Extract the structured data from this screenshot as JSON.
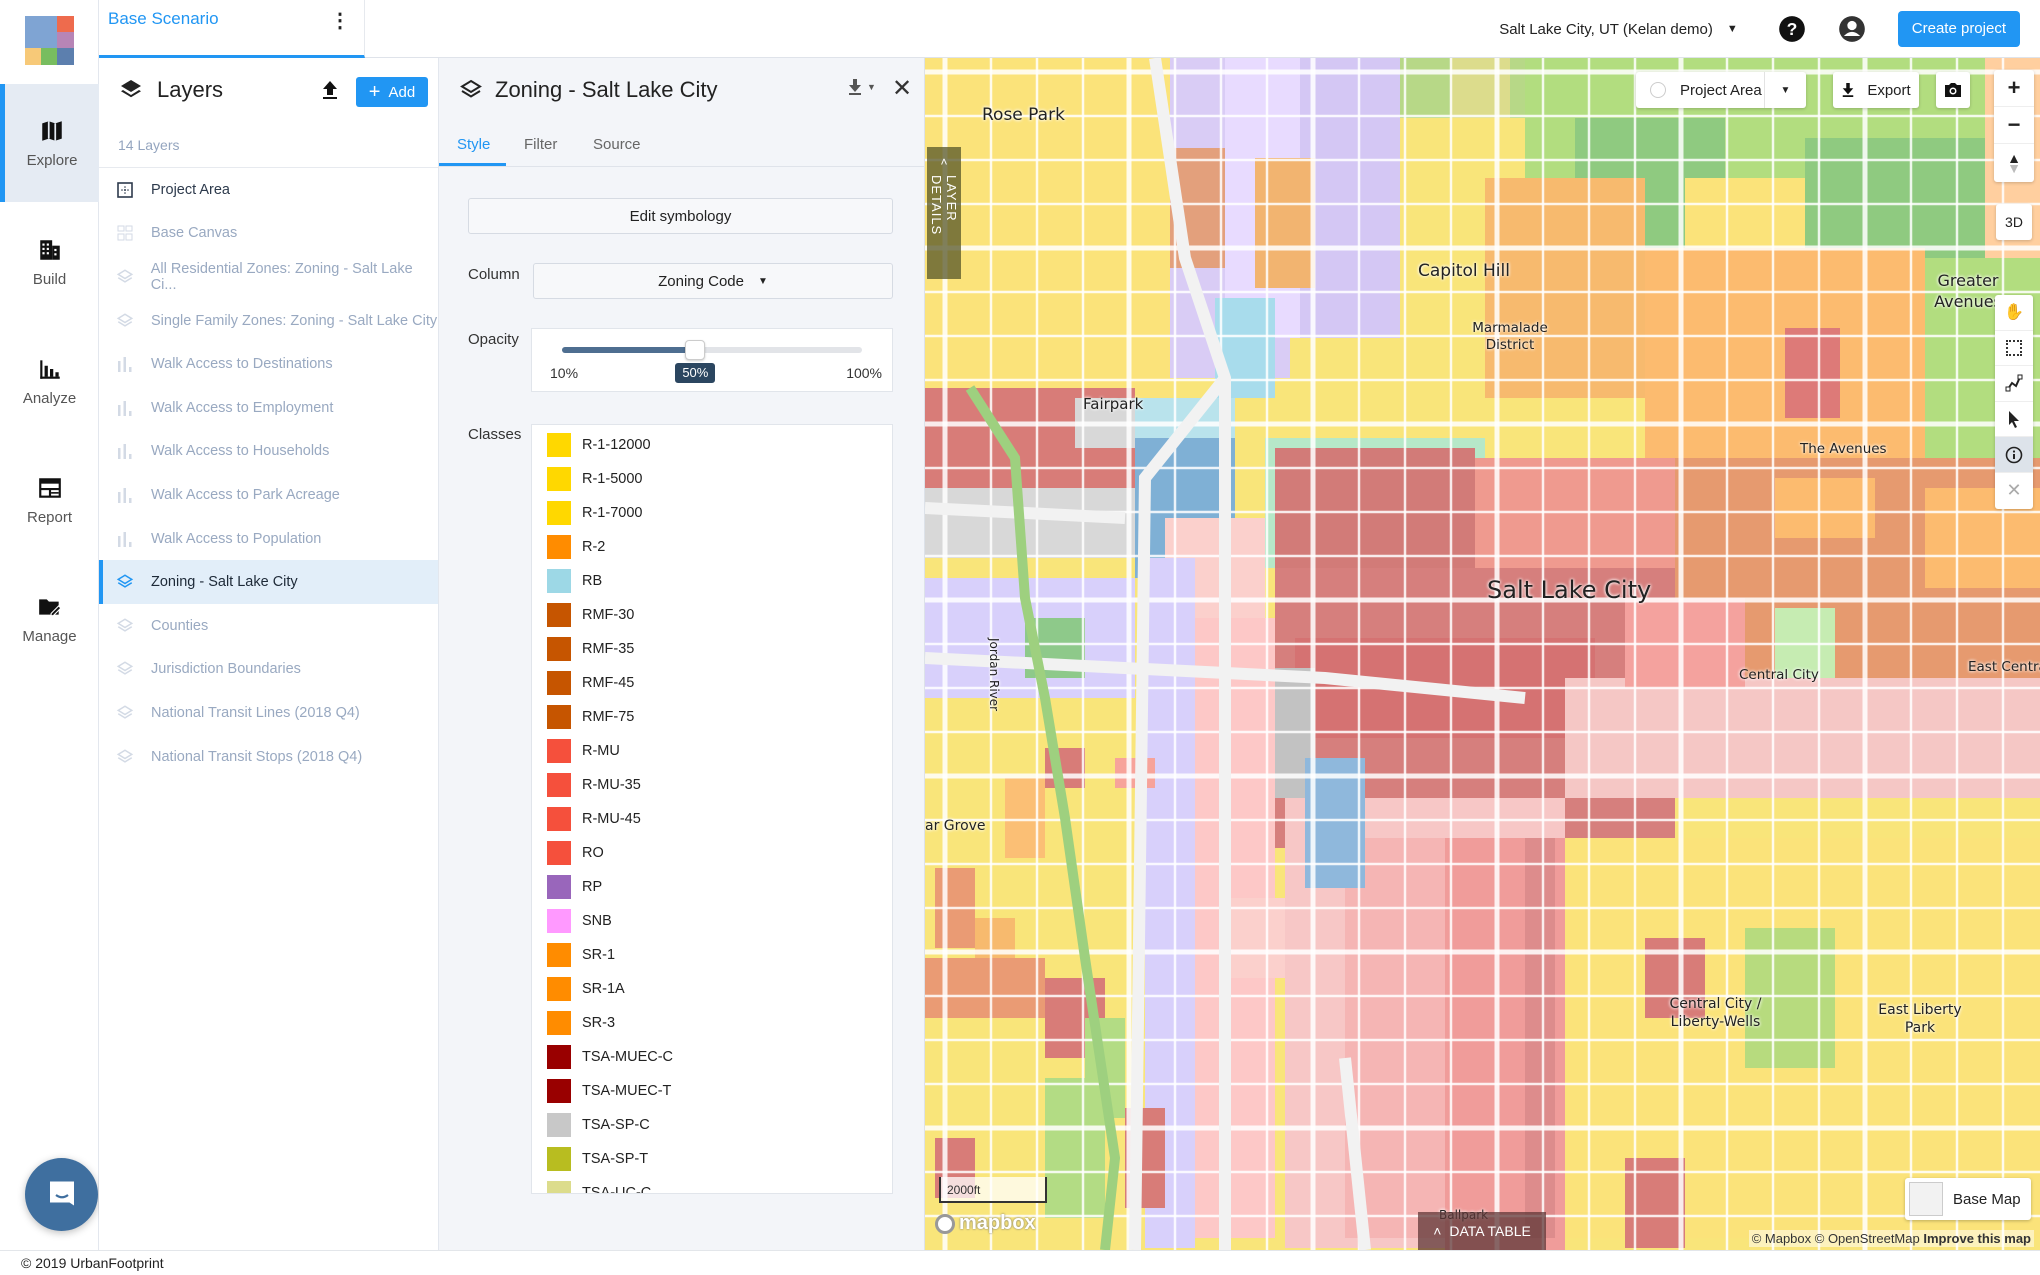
{
  "app": {
    "copyright": "© 2019 UrbanFootprint",
    "logo_colors": [
      "#7fa4d3",
      "#ee6b4d",
      "#b785b6",
      "#f7c978",
      "#78bd5f",
      "#5c7fae"
    ]
  },
  "nav": {
    "items": [
      {
        "label": "Explore",
        "icon": "map-icon",
        "active": true
      },
      {
        "label": "Build",
        "icon": "building-icon",
        "active": false
      },
      {
        "label": "Analyze",
        "icon": "bar-chart-icon",
        "active": false
      },
      {
        "label": "Report",
        "icon": "report-icon",
        "active": false
      },
      {
        "label": "Manage",
        "icon": "folder-edit-icon",
        "active": false
      }
    ]
  },
  "topbar": {
    "scenario": "Base Scenario",
    "location": "Salt Lake City, UT (Kelan demo)",
    "create_project": "Create project"
  },
  "layers_panel": {
    "title": "Layers",
    "add_label": "Add",
    "count_label": "14 Layers",
    "items": [
      {
        "label": "Project Area",
        "icon": "project-area-icon",
        "state": "active"
      },
      {
        "label": "Base Canvas",
        "icon": "canvas-icon",
        "state": "inactive"
      },
      {
        "label": "All Residential Zones: Zoning - Salt Lake Ci...",
        "icon": "layers-icon",
        "state": "inactive"
      },
      {
        "label": "Single Family Zones: Zoning - Salt Lake City",
        "icon": "layers-icon",
        "state": "inactive"
      },
      {
        "label": "Walk Access to Destinations",
        "icon": "bar-chart-icon",
        "state": "inactive"
      },
      {
        "label": "Walk Access to Employment",
        "icon": "bar-chart-icon",
        "state": "inactive"
      },
      {
        "label": "Walk Access to Households",
        "icon": "bar-chart-icon",
        "state": "inactive"
      },
      {
        "label": "Walk Access to Park Acreage",
        "icon": "bar-chart-icon",
        "state": "inactive"
      },
      {
        "label": "Walk Access to Population",
        "icon": "bar-chart-icon",
        "state": "inactive"
      },
      {
        "label": "Zoning - Salt Lake City",
        "icon": "layers-icon",
        "state": "selected"
      },
      {
        "label": "Counties",
        "icon": "layers-icon",
        "state": "inactive"
      },
      {
        "label": "Jurisdiction Boundaries",
        "icon": "layers-icon",
        "state": "inactive"
      },
      {
        "label": "National Transit Lines (2018 Q4)",
        "icon": "layers-icon",
        "state": "inactive"
      },
      {
        "label": "National Transit Stops (2018 Q4)",
        "icon": "layers-icon",
        "state": "inactive"
      }
    ]
  },
  "details": {
    "title": "Zoning - Salt Lake City",
    "tabs": [
      "Style",
      "Filter",
      "Source"
    ],
    "active_tab": "Style",
    "edit_symbology": "Edit symbology",
    "column_label": "Column",
    "column_value": "Zoning Code",
    "opacity_label": "Opacity",
    "opacity_min": "10%",
    "opacity_max": "100%",
    "opacity_value": "50%",
    "opacity_fraction": 0.5,
    "classes_label": "Classes",
    "classes": [
      {
        "label": "R-1-12000",
        "color": "#ffd800"
      },
      {
        "label": "R-1-5000",
        "color": "#ffd800"
      },
      {
        "label": "R-1-7000",
        "color": "#ffd800"
      },
      {
        "label": "R-2",
        "color": "#ff8c00"
      },
      {
        "label": "RB",
        "color": "#9dd8e6"
      },
      {
        "label": "RMF-30",
        "color": "#c65500"
      },
      {
        "label": "RMF-35",
        "color": "#c65500"
      },
      {
        "label": "RMF-45",
        "color": "#c65500"
      },
      {
        "label": "RMF-75",
        "color": "#c65500"
      },
      {
        "label": "R-MU",
        "color": "#f5503c"
      },
      {
        "label": "R-MU-35",
        "color": "#f5503c"
      },
      {
        "label": "R-MU-45",
        "color": "#f5503c"
      },
      {
        "label": "RO",
        "color": "#f5503c"
      },
      {
        "label": "RP",
        "color": "#9966bb"
      },
      {
        "label": "SNB",
        "color": "#ff99ff"
      },
      {
        "label": "SR-1",
        "color": "#ff8c00"
      },
      {
        "label": "SR-1A",
        "color": "#ff8c00"
      },
      {
        "label": "SR-3",
        "color": "#ff8c00"
      },
      {
        "label": "TSA-MUEC-C",
        "color": "#990000"
      },
      {
        "label": "TSA-MUEC-T",
        "color": "#990000"
      },
      {
        "label": "TSA-SP-C",
        "color": "#c8c8c8"
      },
      {
        "label": "TSA-SP-T",
        "color": "#b8bd20"
      },
      {
        "label": "TSA-UC-C",
        "color": "#dcdc8c"
      }
    ]
  },
  "map": {
    "project_area_btn": "Project Area",
    "export_btn": "Export",
    "three_d": "3D",
    "layer_details_tab": "LAYER DETAILS",
    "scale": "2000ft",
    "mapbox": "mapbox",
    "data_table": "DATA TABLE",
    "base_map": "Base Map",
    "attribution": "© Mapbox © OpenStreetMap",
    "improve": "Improve this map",
    "labels": [
      {
        "text": "Rose Park",
        "size": "large"
      },
      {
        "text": "Capitol Hill",
        "size": "large"
      },
      {
        "text": "Marmalade District",
        "size": "small"
      },
      {
        "text": "Greater Avenues",
        "size": "large"
      },
      {
        "text": "Fairpark",
        "size": "large"
      },
      {
        "text": "The Avenues",
        "size": "small"
      },
      {
        "text": "Salt Lake City",
        "size": "xlarge"
      },
      {
        "text": "Central City",
        "size": "small"
      },
      {
        "text": "East Central",
        "size": "small"
      },
      {
        "text": "Jordan River",
        "size": "small"
      },
      {
        "text": "ar Grove",
        "size": "small"
      },
      {
        "text": "Central City / Liberty-Wells",
        "size": "small"
      },
      {
        "text": "East Liberty Park",
        "size": "small"
      },
      {
        "text": "Ballpark",
        "size": "small"
      }
    ]
  }
}
